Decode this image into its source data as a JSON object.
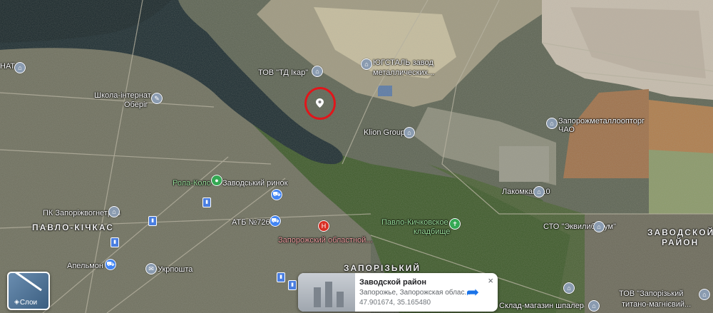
{
  "map": {
    "labels": {
      "nat": "НАТ",
      "tov_td_ikar": "ТОВ \"ТД Ікар\"",
      "yugstal": "ЮГСТАЛЬ завод",
      "yugstal2": "металлических...",
      "shkola": "Школа-інтернат",
      "shkola2": "Оберіг",
      "zaporozh_metal": "Запорожметаллоопторг",
      "zaporozh_metal2": "ЧАО",
      "klion": "Klion Group",
      "rola_kolo": "Рола-Коло",
      "zavodsky_rynok": "Заводський ринок",
      "lakomka": "Лакомка2010",
      "pk": "ПК Запоріжвогнетрив",
      "atb": "АТБ №726",
      "pavlo_kichkas": "ПАВЛО-КІЧКАС",
      "zap_oblastnoi": "Запорожский областной...",
      "kladbishche": "Павло-Кичковское",
      "kladbishche2": "кладбище",
      "sto": "СТО \"Эквилибриум\"",
      "zavodskoy_raion": "ЗАВОДСКОЙ",
      "zavodskoy_raion2": "РАЙОН",
      "apelmon": "Апельмон",
      "ukrposhta": "Укрпошта",
      "zaporizky": "ЗАПОРІЗЬКИЙ",
      "sklad": "Склад-магазин шпалер",
      "tov_zap": "ТОВ \"Запорізький",
      "tov_zap2": "титано-магнієвий..."
    }
  },
  "controls": {
    "layers_label": "Слои"
  },
  "place_card": {
    "title": "Заводской район",
    "address": "Запорожье, Запорожская облас...",
    "coords": "47.901674, 35.165480",
    "close": "×"
  }
}
